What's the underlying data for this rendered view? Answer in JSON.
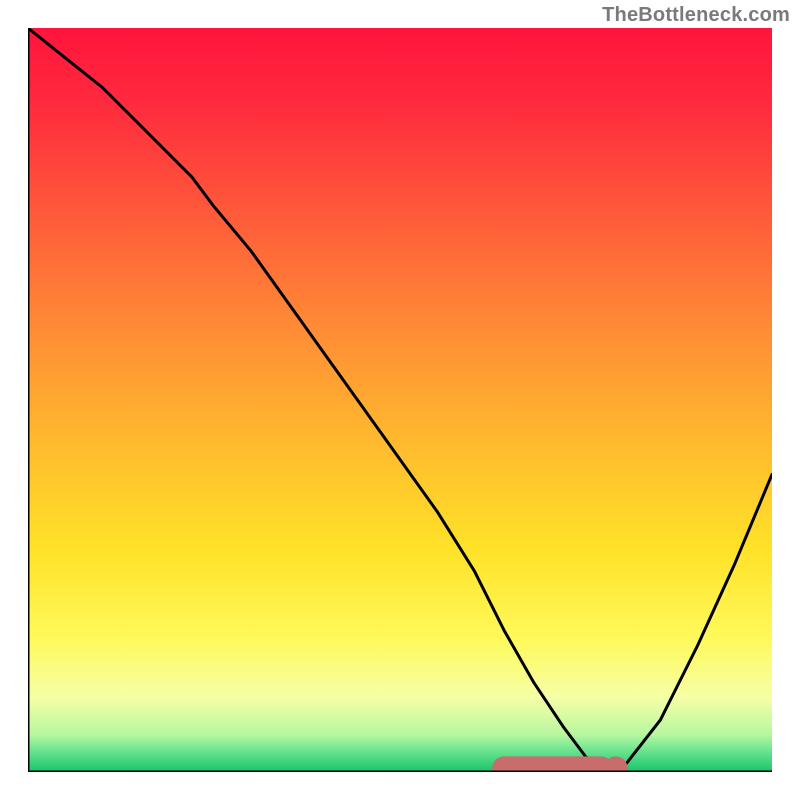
{
  "watermark": "TheBottleneck.com",
  "chart_data": {
    "type": "line",
    "title": "",
    "xlabel": "",
    "ylabel": "",
    "xlim": [
      0,
      100
    ],
    "ylim": [
      0,
      100
    ],
    "x": [
      0,
      5,
      10,
      15,
      20,
      22,
      25,
      30,
      35,
      40,
      45,
      50,
      55,
      60,
      64,
      68,
      72,
      75,
      78,
      80,
      85,
      90,
      95,
      100
    ],
    "values": [
      100,
      96,
      92,
      87,
      82,
      80,
      76,
      70,
      63,
      56,
      49,
      42,
      35,
      27,
      19,
      12,
      6,
      2,
      0.5,
      0.6,
      7,
      17,
      28,
      40
    ],
    "gradient_stops": [
      {
        "offset": 0.0,
        "color": "#ff143c"
      },
      {
        "offset": 0.1,
        "color": "#ff2a3e"
      },
      {
        "offset": 0.25,
        "color": "#ff5a3a"
      },
      {
        "offset": 0.4,
        "color": "#ff8a36"
      },
      {
        "offset": 0.55,
        "color": "#ffb82e"
      },
      {
        "offset": 0.7,
        "color": "#ffe228"
      },
      {
        "offset": 0.82,
        "color": "#fff95a"
      },
      {
        "offset": 0.9,
        "color": "#f6ffa6"
      },
      {
        "offset": 0.95,
        "color": "#b6f7a0"
      },
      {
        "offset": 0.975,
        "color": "#5fe08c"
      },
      {
        "offset": 1.0,
        "color": "#18c46a"
      }
    ],
    "marker_band": {
      "color": "#c96c6c",
      "y": 0.5,
      "x_start": 64,
      "x_end": 77,
      "dot_x": 79,
      "thickness": 3.2
    }
  }
}
